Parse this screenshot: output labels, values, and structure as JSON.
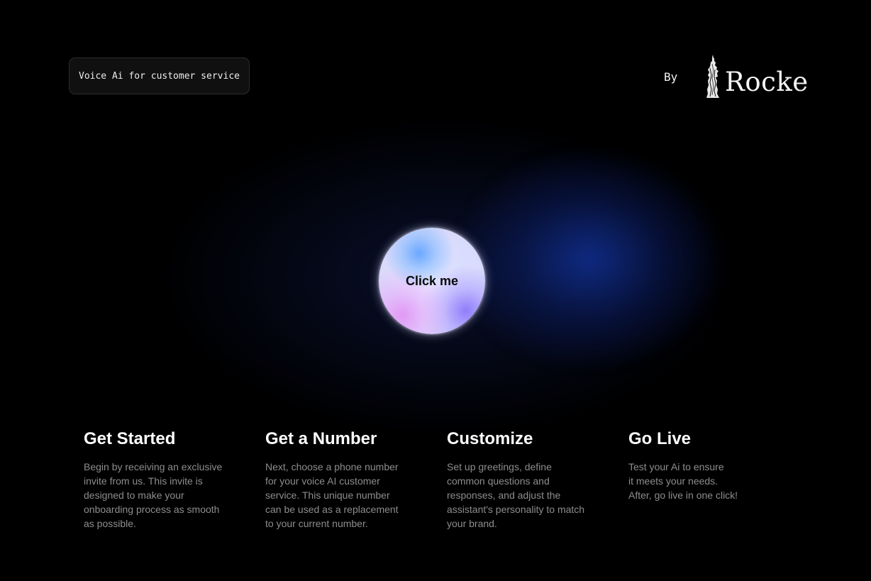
{
  "header": {
    "tagline": "Voice Ai for customer service",
    "brand_prefix": "By",
    "brand_name": "Rocke",
    "brand_icon": "statue-icon"
  },
  "hero": {
    "button_label": "Click me"
  },
  "steps": [
    {
      "title": "Get Started",
      "lines": [
        "Begin by receiving an exclusive",
        "invite from us. This invite is",
        "designed to make your",
        "onboarding process as smooth",
        "as possible."
      ]
    },
    {
      "title": "Get a Number",
      "lines": [
        "Next, choose a phone number",
        "for your voice AI customer",
        "service. This unique number",
        "can be used as a replacement",
        "to your current number."
      ]
    },
    {
      "title": "Customize",
      "lines": [
        "Set up greetings, define",
        "common questions and",
        "responses, and adjust the",
        "assistant's personality to match",
        "your brand."
      ]
    },
    {
      "title": "Go Live",
      "lines": [
        "Test your Ai to ensure",
        "it meets your needs.",
        "After, go live in one click!"
      ]
    }
  ],
  "colors": {
    "background": "#000000",
    "glow": "#1234a0",
    "text_primary": "#ffffff",
    "text_secondary": "#8d8d8d"
  }
}
